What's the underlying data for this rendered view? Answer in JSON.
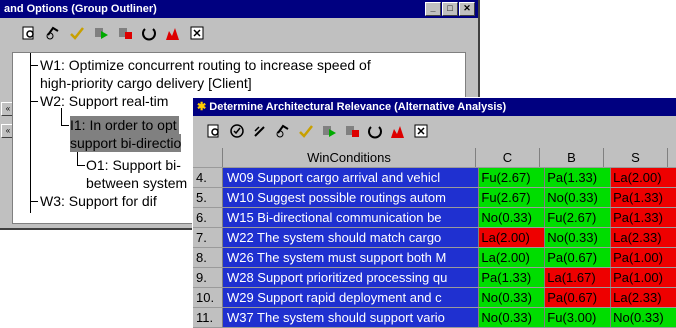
{
  "outliner": {
    "title": "and Options (Group Outliner)",
    "toolbar_icons": [
      "zoom-icon",
      "approve-icon",
      "check-icon",
      "run-icon",
      "stop-icon",
      "refresh-icon",
      "chart-icon",
      "close-box-icon"
    ],
    "lines": [
      "W1: Optimize concurrent routing to increase speed of",
      "high-priority cargo delivery [Client]",
      "W2: Support real-tim",
      "I1: In order to opt",
      "support bi-directio",
      "O1: Support bi-",
      "between system",
      "W3: Support for dif"
    ]
  },
  "analysis": {
    "title": "Determine Architectural Relevance (Alternative Analysis)",
    "toolbar_icons": [
      "zoom-icon",
      "check-circle-icon",
      "edit-icon",
      "approve-icon",
      "check-icon",
      "run-icon",
      "stop-icon",
      "refresh-icon",
      "chart-icon",
      "close-box-icon"
    ],
    "columns": [
      "WinConditions",
      "C",
      "B",
      "S"
    ],
    "rows": [
      {
        "num": "4.",
        "wc": "W09 Support cargo arrival and vehicl",
        "c": "Fu(2.67)",
        "b": "Pa(1.33)",
        "s": "La(2.00)",
        "cc": "green",
        "bc": "green",
        "sc": "red"
      },
      {
        "num": "5.",
        "wc": "W10 Suggest possible routings autom",
        "c": "Fu(2.67)",
        "b": "No(0.33)",
        "s": "Pa(1.33)",
        "cc": "green",
        "bc": "green",
        "sc": "red"
      },
      {
        "num": "6.",
        "wc": "W15 Bi-directional communication be",
        "c": "No(0.33)",
        "b": "Fu(2.67)",
        "s": "Pa(1.33)",
        "cc": "green",
        "bc": "green",
        "sc": "red"
      },
      {
        "num": "7.",
        "wc": "W22 The system should match cargo",
        "c": "La(2.00)",
        "b": "No(0.33)",
        "s": "La(2.33)",
        "cc": "red",
        "bc": "green",
        "sc": "red"
      },
      {
        "num": "8.",
        "wc": "W26 The system must support both M",
        "c": "La(2.00)",
        "b": "Pa(0.67)",
        "s": "Pa(1.00)",
        "cc": "green",
        "bc": "green",
        "sc": "red"
      },
      {
        "num": "9.",
        "wc": "W28 Support prioritized processing qu",
        "c": "Pa(1.33)",
        "b": "La(1.67)",
        "s": "Pa(1.00)",
        "cc": "green",
        "bc": "red",
        "sc": "red"
      },
      {
        "num": "10.",
        "wc": "W29 Support rapid deployment and c",
        "c": "No(0.33)",
        "b": "Pa(0.67)",
        "s": "La(2.33)",
        "cc": "green",
        "bc": "red",
        "sc": "red"
      },
      {
        "num": "11.",
        "wc": "W37 The system should support vario",
        "c": "No(0.33)",
        "b": "Fu(3.00)",
        "s": "No(0.33)",
        "cc": "green",
        "bc": "green",
        "sc": "green"
      }
    ]
  }
}
